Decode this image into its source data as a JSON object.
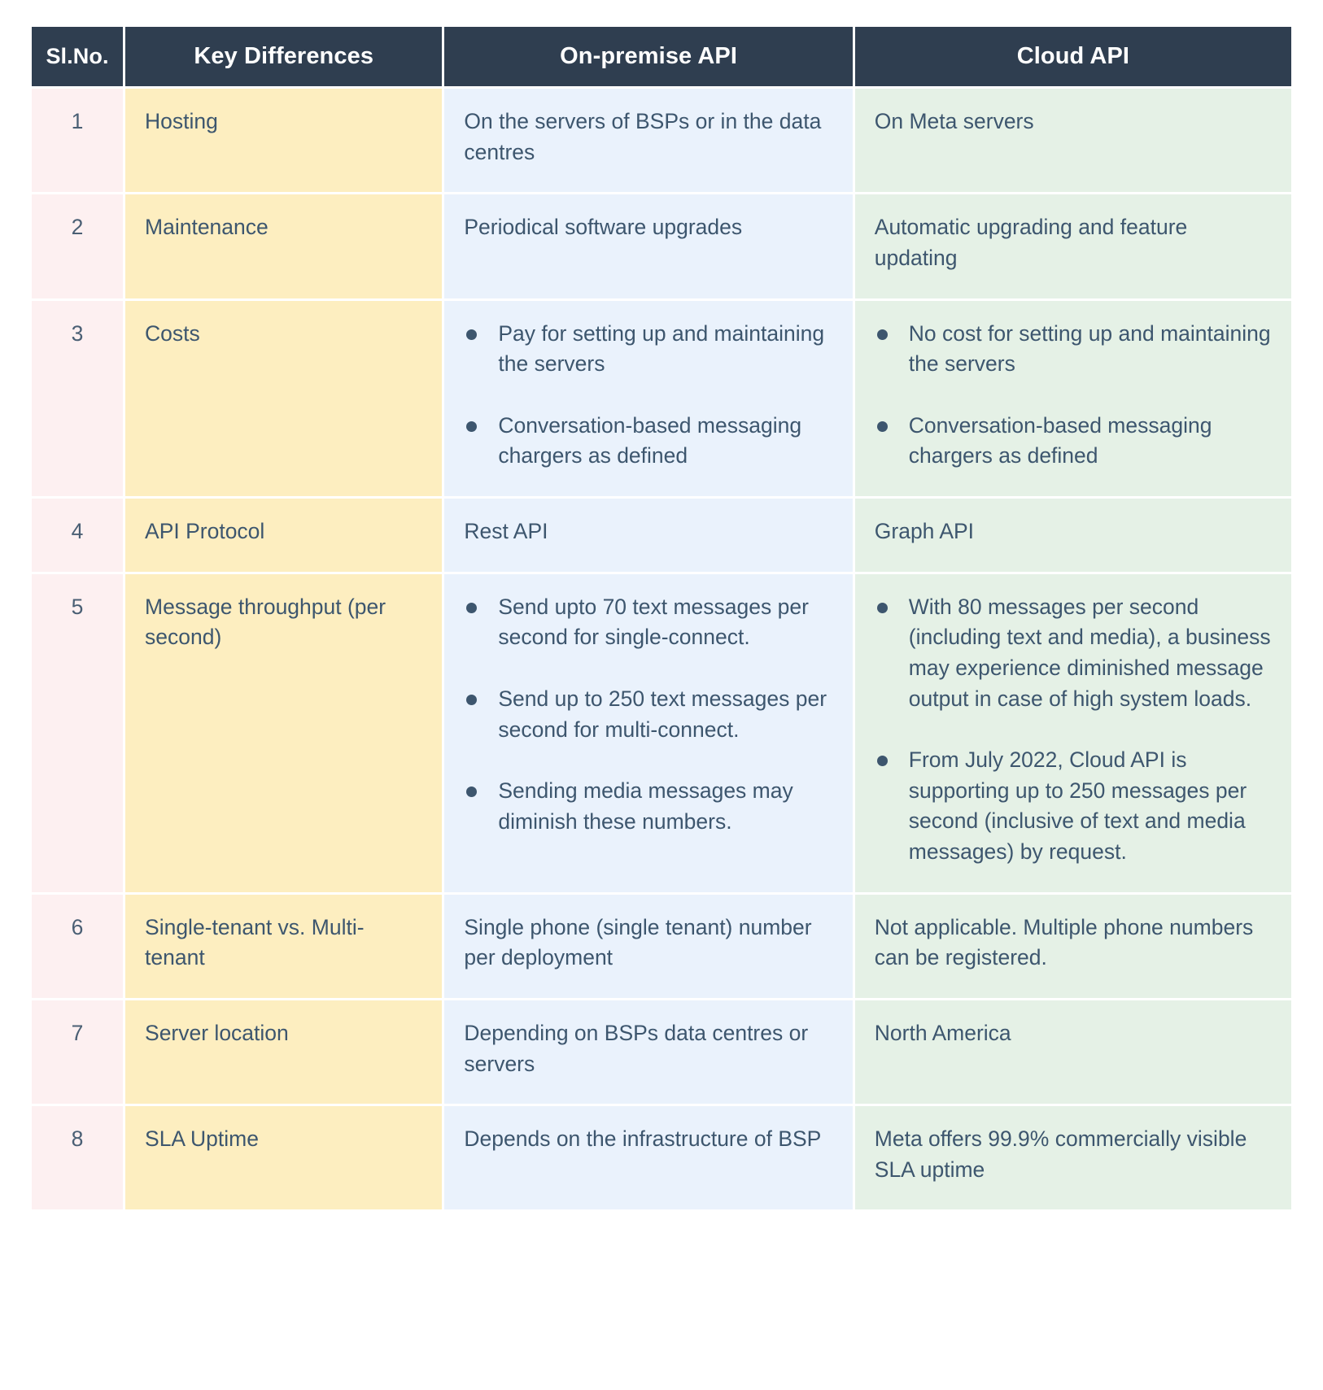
{
  "table": {
    "headers": {
      "sl_no": "Sl.No.",
      "key_differences": "Key Differences",
      "on_premise_api": "On-premise API",
      "cloud_api": "Cloud API"
    },
    "colors": {
      "header_bg": "#2f3e50",
      "header_text": "#ffffff",
      "sl_cell_bg": "#fdf0f1",
      "key_cell_bg": "#fdeec0",
      "on_premise_cell_bg": "#eaf2fc",
      "cloud_cell_bg": "#e5f1e6",
      "body_text": "#3d566e",
      "bullet": "#3d566e",
      "page_bg": "#ffffff"
    },
    "rows": [
      {
        "sl_no": "1",
        "key": "Hosting",
        "on_premise": [
          "On the servers of BSPs or in the data centres"
        ],
        "cloud": [
          "On Meta servers"
        ],
        "on_premise_bulleted": false,
        "cloud_bulleted": false
      },
      {
        "sl_no": "2",
        "key": "Maintenance",
        "on_premise": [
          "Periodical software upgrades"
        ],
        "cloud": [
          "Automatic upgrading and feature updating"
        ],
        "on_premise_bulleted": false,
        "cloud_bulleted": false
      },
      {
        "sl_no": "3",
        "key": "Costs",
        "on_premise": [
          "Pay for setting up and maintaining the servers",
          "Conversation-based messaging chargers as defined"
        ],
        "cloud": [
          "No cost for setting up and maintaining the servers",
          "Conversation-based messaging chargers as defined"
        ],
        "on_premise_bulleted": true,
        "cloud_bulleted": true
      },
      {
        "sl_no": "4",
        "key": "API Protocol",
        "on_premise": [
          "Rest API"
        ],
        "cloud": [
          "Graph API"
        ],
        "on_premise_bulleted": false,
        "cloud_bulleted": false
      },
      {
        "sl_no": "5",
        "key": "Message throughput (per second)",
        "on_premise": [
          "Send upto 70 text messages per second for single-connect.",
          "Send up to 250 text messages per second for multi-connect.",
          "Sending media messages may diminish these numbers."
        ],
        "cloud": [
          "With 80 messages per second (including text and media), a business may experience diminished message output in case of high system loads.",
          "From July 2022, Cloud API is supporting up to 250 messages per second (inclusive of text and media messages) by request."
        ],
        "on_premise_bulleted": true,
        "cloud_bulleted": true
      },
      {
        "sl_no": "6",
        "key": "Single-tenant vs. Multi-tenant",
        "on_premise": [
          "Single phone (single tenant) number per deployment"
        ],
        "cloud": [
          "Not applicable. Multiple phone numbers can be registered."
        ],
        "on_premise_bulleted": false,
        "cloud_bulleted": false
      },
      {
        "sl_no": "7",
        "key": "Server location",
        "on_premise": [
          "Depending on BSPs data centres or servers"
        ],
        "cloud": [
          "North America"
        ],
        "on_premise_bulleted": false,
        "cloud_bulleted": false
      },
      {
        "sl_no": "8",
        "key": "SLA Uptime",
        "on_premise": [
          "Depends on the infrastructure of BSP"
        ],
        "cloud": [
          "Meta offers 99.9% commercially visible SLA uptime"
        ],
        "on_premise_bulleted": false,
        "cloud_bulleted": false
      }
    ]
  }
}
